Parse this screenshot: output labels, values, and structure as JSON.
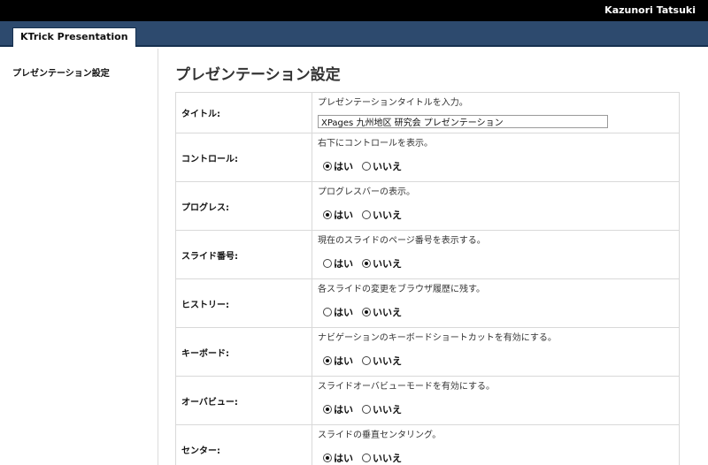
{
  "header": {
    "user_name": "Kazunori Tatsuki"
  },
  "app": {
    "tab_label": "KTrick Presentation"
  },
  "sidebar": {
    "items": [
      {
        "label": "プレゼンテーション設定"
      }
    ]
  },
  "main": {
    "title": "プレゼンテーション設定",
    "settings": {
      "title_field": {
        "label": "タイトル:",
        "description": "プレゼンテーションタイトルを入力。",
        "value": "XPages 九州地区 研究会 プレゼンテーション"
      },
      "rows": [
        {
          "label": "コントロール:",
          "description": "右下にコントロールを表示。",
          "yes": "はい",
          "no": "いいえ",
          "selected": "yes"
        },
        {
          "label": "プログレス:",
          "description": "プログレスバーの表示。",
          "yes": "はい",
          "no": "いいえ",
          "selected": "yes"
        },
        {
          "label": "スライド番号:",
          "description": "現在のスライドのページ番号を表示する。",
          "yes": "はい",
          "no": "いいえ",
          "selected": "no"
        },
        {
          "label": "ヒストリー:",
          "description": "各スライドの変更をブラウザ履歴に残す。",
          "yes": "はい",
          "no": "いいえ",
          "selected": "no"
        },
        {
          "label": "キーボード:",
          "description": "ナビゲーションのキーボードショートカットを有効にする。",
          "yes": "はい",
          "no": "いいえ",
          "selected": "yes"
        },
        {
          "label": "オーバビュー:",
          "description": "スライドオーバビューモードを有効にする。",
          "yes": "はい",
          "no": "いいえ",
          "selected": "yes"
        },
        {
          "label": "センター:",
          "description": "スライドの垂直センタリング。",
          "yes": "はい",
          "no": "いいえ",
          "selected": "yes"
        }
      ]
    }
  }
}
